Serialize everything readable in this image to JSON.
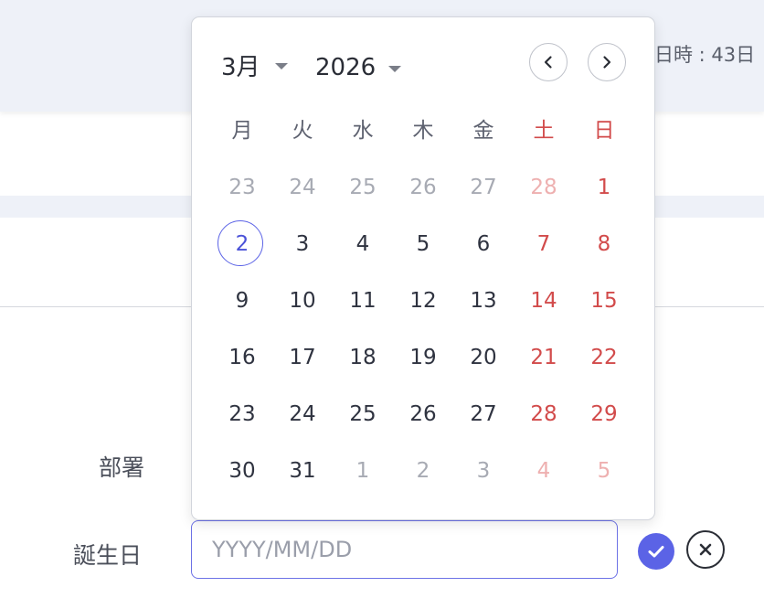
{
  "header": {
    "meta_text": "日時 : 43日"
  },
  "form": {
    "department_label": "部署",
    "birthday_label": "誕生日",
    "birthday_placeholder": "YYYY/MM/DD",
    "birthday_value": ""
  },
  "calendar": {
    "month_label": "3月",
    "year_label": "2026",
    "weekdays": [
      "月",
      "火",
      "水",
      "木",
      "金",
      "土",
      "日"
    ],
    "weeks": [
      [
        {
          "d": "23",
          "m": true
        },
        {
          "d": "24",
          "m": true
        },
        {
          "d": "25",
          "m": true
        },
        {
          "d": "26",
          "m": true
        },
        {
          "d": "27",
          "m": true
        },
        {
          "d": "28",
          "m": true,
          "w": true
        },
        {
          "d": "1",
          "w": true
        }
      ],
      [
        {
          "d": "2",
          "sel": true
        },
        {
          "d": "3"
        },
        {
          "d": "4"
        },
        {
          "d": "5"
        },
        {
          "d": "6"
        },
        {
          "d": "7",
          "w": true
        },
        {
          "d": "8",
          "w": true
        }
      ],
      [
        {
          "d": "9"
        },
        {
          "d": "10"
        },
        {
          "d": "11"
        },
        {
          "d": "12"
        },
        {
          "d": "13"
        },
        {
          "d": "14",
          "w": true
        },
        {
          "d": "15",
          "w": true
        }
      ],
      [
        {
          "d": "16"
        },
        {
          "d": "17"
        },
        {
          "d": "18"
        },
        {
          "d": "19"
        },
        {
          "d": "20"
        },
        {
          "d": "21",
          "w": true
        },
        {
          "d": "22",
          "w": true
        }
      ],
      [
        {
          "d": "23"
        },
        {
          "d": "24"
        },
        {
          "d": "25"
        },
        {
          "d": "26"
        },
        {
          "d": "27"
        },
        {
          "d": "28",
          "w": true
        },
        {
          "d": "29",
          "w": true
        }
      ],
      [
        {
          "d": "30"
        },
        {
          "d": "31"
        },
        {
          "d": "1",
          "m": true
        },
        {
          "d": "2",
          "m": true
        },
        {
          "d": "3",
          "m": true
        },
        {
          "d": "4",
          "m": true,
          "w": true
        },
        {
          "d": "5",
          "m": true,
          "w": true
        }
      ]
    ],
    "icons": {
      "prev": "chevron-left-icon",
      "next": "chevron-right-icon",
      "month_caret": "caret-down-icon",
      "year_caret": "caret-down-icon"
    }
  },
  "actions": {
    "confirm_icon": "checkmark-icon",
    "cancel_icon": "close-icon"
  },
  "colors": {
    "accent": "#5b63e6",
    "weekend": "#d24b4b",
    "muted": "#a7aab3",
    "header_bg": "#eef1f8"
  }
}
